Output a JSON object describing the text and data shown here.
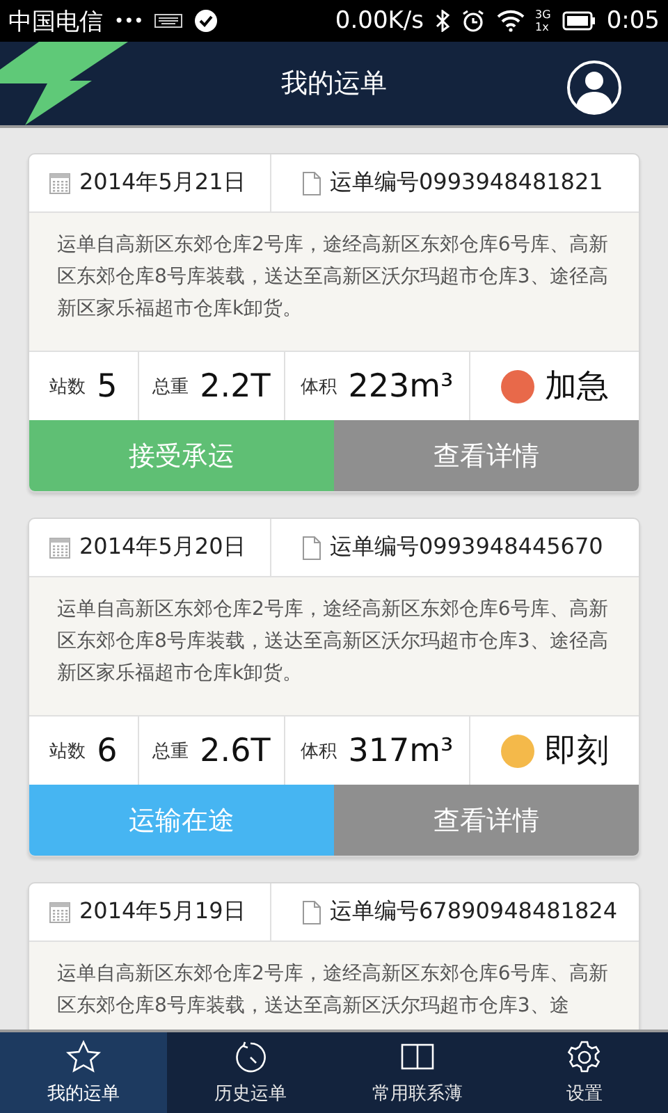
{
  "status_bar": {
    "carrier": "中国电信",
    "dots": "•••",
    "speed": "0.00K/s",
    "network": "3G",
    "network_sub": "1x",
    "time": "0:05"
  },
  "header": {
    "title": "我的运单"
  },
  "orders": [
    {
      "date": "2014年5月21日",
      "number": "运单编号0993948481821",
      "description": "运单自高新区东郊仓库2号库，途经高新区东郊仓库6号库、高新区东郊仓库8号库装载，送达至高新区沃尔玛超市仓库3、途径高新区家乐福超市仓库k卸货。",
      "stats": [
        {
          "label": "站数",
          "value": "5"
        },
        {
          "label": "总重",
          "value": "2.2T"
        },
        {
          "label": "体积",
          "value": "223m³"
        }
      ],
      "priority": {
        "label": "加急",
        "color": "#e8694a"
      },
      "actions": [
        {
          "label": "接受承运",
          "kind": "accept"
        },
        {
          "label": "查看详情",
          "kind": "details"
        }
      ]
    },
    {
      "date": "2014年5月20日",
      "number": "运单编号0993948445670",
      "description": "运单自高新区东郊仓库2号库，途经高新区东郊仓库6号库、高新区东郊仓库8号库装载，送达至高新区沃尔玛超市仓库3、途径高新区家乐福超市仓库k卸货。",
      "stats": [
        {
          "label": "站数",
          "value": "6"
        },
        {
          "label": "总重",
          "value": "2.6T"
        },
        {
          "label": "体积",
          "value": "317m³"
        }
      ],
      "priority": {
        "label": "即刻",
        "color": "#f4b94a"
      },
      "actions": [
        {
          "label": "运输在途",
          "kind": "transit"
        },
        {
          "label": "查看详情",
          "kind": "details"
        }
      ]
    },
    {
      "date": "2014年5月19日",
      "number": "运单编号67890948481824",
      "description": "运单自高新区东郊仓库2号库，途经高新区东郊仓库6号库、高新区东郊仓库8号库装载，送达至高新区沃尔玛超市仓库3、途"
    }
  ],
  "nav": [
    {
      "label": "我的运单",
      "selected": true
    },
    {
      "label": "历史运单",
      "selected": false
    },
    {
      "label": "常用联系薄",
      "selected": false
    },
    {
      "label": "设置",
      "selected": false
    }
  ]
}
